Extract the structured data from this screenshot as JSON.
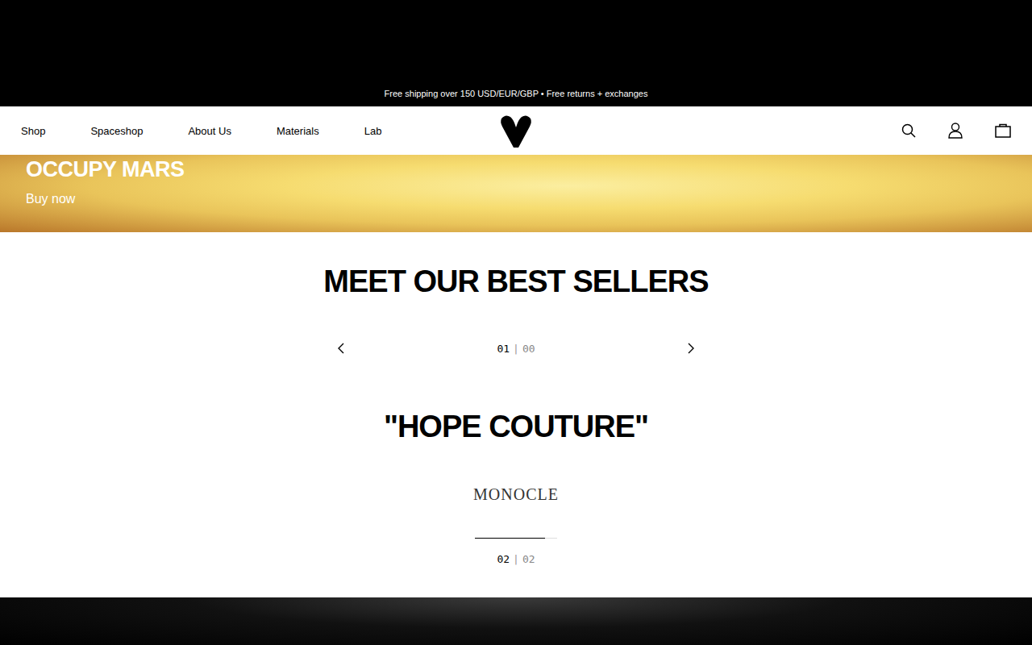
{
  "announcement": "Free shipping over 150 USD/EUR/GBP • Free returns + exchanges",
  "nav": {
    "items": [
      "Shop",
      "Spaceshop",
      "About Us",
      "Materials",
      "Lab"
    ]
  },
  "hero": {
    "title": "OCCUPY MARS",
    "cta": "Buy now"
  },
  "best_sellers": {
    "title": "MEET OUR BEST SELLERS",
    "current": "01",
    "separator": "|",
    "total": "00"
  },
  "press": {
    "quote": "\"HOPE COUTURE\"",
    "source": "MONOCLE",
    "level": 0.85,
    "current": "02",
    "separator": "|",
    "total": "02"
  }
}
